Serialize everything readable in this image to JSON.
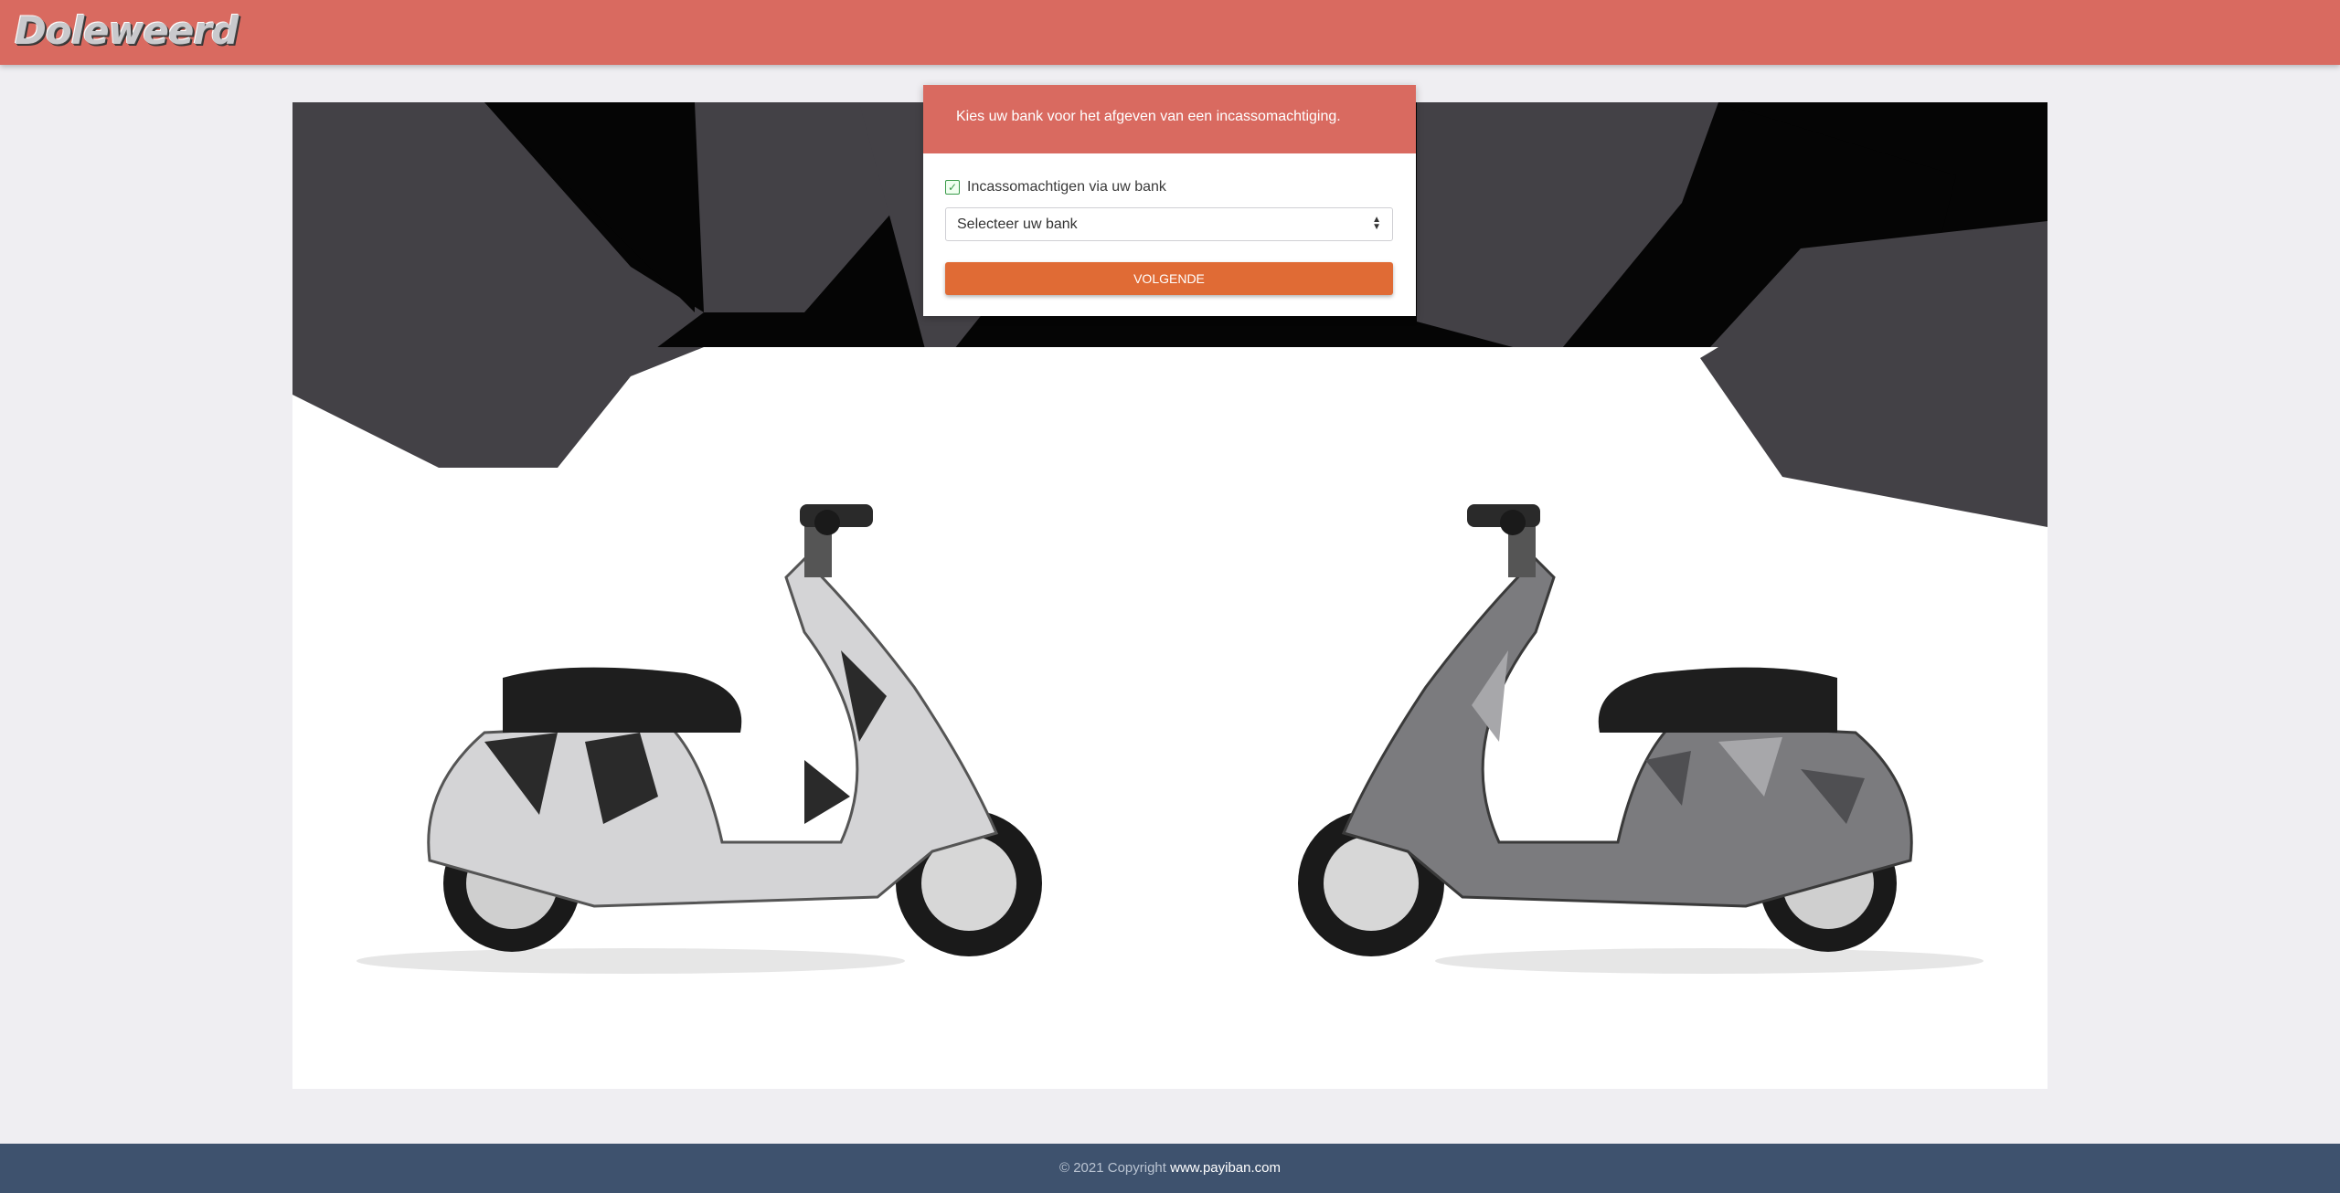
{
  "header": {
    "logo_text": "Doleweerd",
    "background": "#d96a60"
  },
  "card": {
    "header_text": "Kies uw bank voor het afgeven van een incassomachtiging.",
    "checkbox_label": "Incassomachtigen via uw bank",
    "checkbox_checked": true,
    "select_value": "Selecteer uw bank",
    "button_label": "VOLGENDE",
    "button_color": "#e06b35"
  },
  "hero": {
    "image": "two-camouflage-scooters-icon"
  },
  "footer": {
    "copyright": "© 2021 Copyright",
    "link_text": "www.payiban.com",
    "background": "#3e526e"
  }
}
